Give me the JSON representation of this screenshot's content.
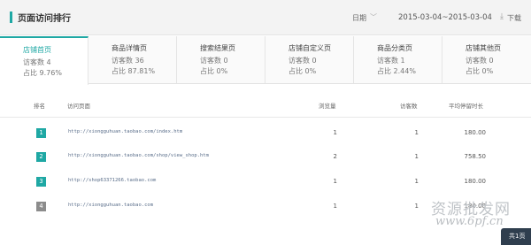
{
  "header": {
    "title": "页面访问排行",
    "date_label": "日期",
    "date_range": "2015-03-04~2015-03-04",
    "download_label": "下载"
  },
  "tabs": [
    {
      "name": "店铺首页",
      "visits": "访客数 4",
      "share": "占比 9.76%",
      "active": true
    },
    {
      "name": "商品详情页",
      "visits": "访客数 36",
      "share": "占比 87.81%",
      "active": false
    },
    {
      "name": "搜索结果页",
      "visits": "访客数 0",
      "share": "占比 0%",
      "active": false
    },
    {
      "name": "店铺自定义页",
      "visits": "访客数 0",
      "share": "占比 0%",
      "active": false
    },
    {
      "name": "商品分类页",
      "visits": "访客数 1",
      "share": "占比 2.44%",
      "active": false
    },
    {
      "name": "店铺其他页",
      "visits": "访客数 0",
      "share": "占比 0%",
      "active": false
    }
  ],
  "table": {
    "headers": {
      "rank": "排名",
      "page": "访问页面",
      "views": "浏览量",
      "visitors": "访客数",
      "avg_time": "平均停留时长"
    },
    "rows": [
      {
        "rank": "1",
        "url": "http://xiongguhuan.taobao.com/index.htm",
        "views": "1",
        "visitors": "1",
        "avg_time": "180.00"
      },
      {
        "rank": "2",
        "url": "http://xiongguhuan.taobao.com/shop/view_shop.htm",
        "views": "2",
        "visitors": "1",
        "avg_time": "758.50"
      },
      {
        "rank": "3",
        "url": "http://shop63371266.taobao.com",
        "views": "1",
        "visitors": "1",
        "avg_time": "180.00"
      },
      {
        "rank": "4",
        "url": "http://xiongguhuan.taobao.com",
        "views": "1",
        "visitors": "1",
        "avg_time": "180.00"
      }
    ]
  },
  "overlay": {
    "watermark": "资源批发网",
    "watermark_url": "www.6pf.cn",
    "page_count": "共1页"
  },
  "colors": {
    "accent": "#1fa8a4",
    "rank_gray": "#8c8c8c"
  }
}
